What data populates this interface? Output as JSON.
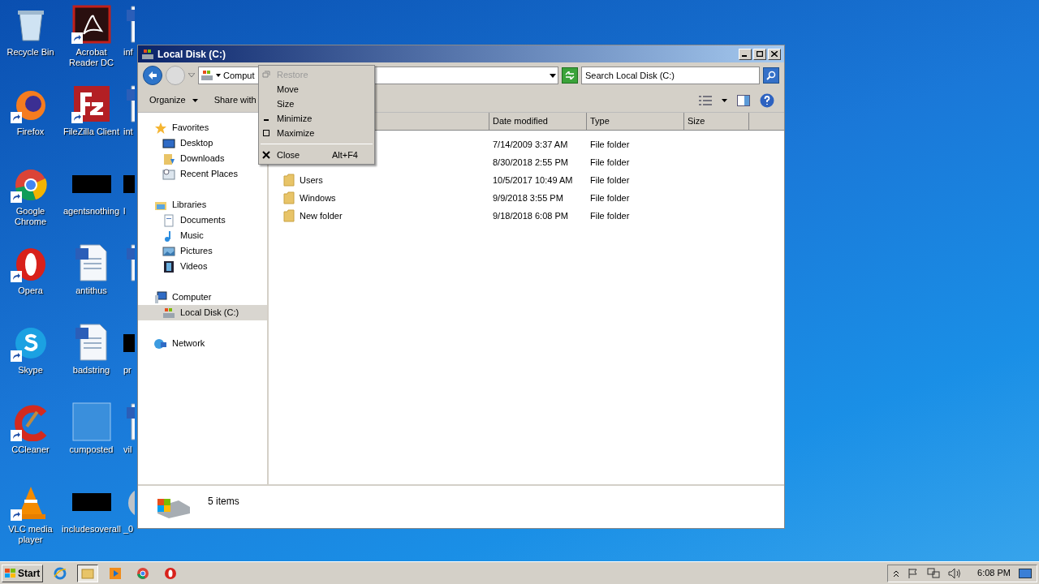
{
  "desktop_icons": [
    {
      "label": "Recycle Bin",
      "kind": "recycle",
      "shortcut": false
    },
    {
      "label": "Firefox",
      "kind": "firefox",
      "shortcut": true
    },
    {
      "label": "Google Chrome",
      "kind": "chrome",
      "shortcut": true
    },
    {
      "label": "Opera",
      "kind": "opera",
      "shortcut": true
    },
    {
      "label": "Skype",
      "kind": "skype",
      "shortcut": true
    },
    {
      "label": "CCleaner",
      "kind": "ccleaner",
      "shortcut": true
    },
    {
      "label": "VLC media player",
      "kind": "vlc",
      "shortcut": true
    },
    {
      "label": "Acrobat Reader DC",
      "kind": "pdf",
      "shortcut": true
    },
    {
      "label": "FileZilla Client",
      "kind": "filezilla",
      "shortcut": true
    },
    {
      "label": "agentsnothing",
      "kind": "black",
      "shortcut": false
    },
    {
      "label": "antithus",
      "kind": "word",
      "shortcut": false
    },
    {
      "label": "badstring",
      "kind": "word",
      "shortcut": false
    },
    {
      "label": "cumposted",
      "kind": "blank",
      "shortcut": false
    },
    {
      "label": "includesoverall",
      "kind": "black",
      "shortcut": false
    }
  ],
  "partial_icons": [
    {
      "label": "inf",
      "kind": "word"
    },
    {
      "label": "int",
      "kind": "word"
    },
    {
      "label": "l",
      "kind": "black"
    },
    {
      "kind": "word"
    },
    {
      "label": "pr",
      "kind": "black"
    },
    {
      "label": "vil",
      "kind": "word"
    },
    {
      "label": "_0",
      "kind": "disc"
    }
  ],
  "window": {
    "title": "Local Disk (C:)",
    "address": "Comput",
    "search": {
      "placeholder": "Search Local Disk (C:)"
    },
    "toolbar": [
      "Organize",
      "Share with"
    ],
    "sidebar": [
      {
        "label": "Favorites",
        "kind": "star",
        "selected": false,
        "children": [
          {
            "label": "Desktop",
            "kind": "desktop",
            "selected": false
          },
          {
            "label": "Downloads",
            "kind": "downloads",
            "selected": false
          },
          {
            "label": "Recent Places",
            "kind": "recent",
            "selected": false
          }
        ]
      },
      {
        "label": "Libraries",
        "kind": "library",
        "selected": false,
        "children": [
          {
            "label": "Documents",
            "kind": "documents",
            "selected": false
          },
          {
            "label": "Music",
            "kind": "music",
            "selected": false
          },
          {
            "label": "Pictures",
            "kind": "pictures",
            "selected": false
          },
          {
            "label": "Videos",
            "kind": "videos",
            "selected": false
          }
        ]
      },
      {
        "label": "Computer",
        "kind": "computer",
        "selected": false,
        "children": [
          {
            "label": "Local Disk (C:)",
            "kind": "drive",
            "selected": true
          }
        ]
      },
      {
        "label": "Network",
        "kind": "network",
        "selected": false
      }
    ],
    "columns": [
      "Date modified",
      "Type",
      "Size"
    ],
    "rows": [
      {
        "date": "7/14/2009 3:37 AM",
        "type": "File folder"
      },
      {
        "date": "8/30/2018 2:55 PM",
        "type": "File folder"
      },
      {
        "name": "Users",
        "date": "10/5/2017 10:49 AM",
        "type": "File folder"
      },
      {
        "name": "Windows",
        "date": "9/9/2018 3:55 PM",
        "type": "File folder"
      },
      {
        "name": "New folder",
        "date": "9/18/2018 6:08 PM",
        "type": "File folder"
      }
    ],
    "status": "5 items"
  },
  "system_menu": [
    {
      "label": "Restore",
      "kind": "restore",
      "disabled": true
    },
    {
      "label": "Move",
      "kind": "plain",
      "disabled": false
    },
    {
      "label": "Size",
      "kind": "plain",
      "disabled": false
    },
    {
      "label": "Minimize",
      "kind": "minimize",
      "disabled": false
    },
    {
      "label": "Maximize",
      "kind": "maximize",
      "disabled": false
    },
    {
      "label": "Close",
      "kind": "close",
      "shortcut": "Alt+F4",
      "disabled": false
    }
  ],
  "taskbar": {
    "start": "Start",
    "apps": [
      {
        "kind": "ie",
        "selected": false
      },
      {
        "kind": "explorer",
        "selected": true
      },
      {
        "kind": "media",
        "selected": false
      },
      {
        "kind": "chrome",
        "selected": false
      },
      {
        "kind": "opera",
        "selected": false
      }
    ],
    "clock": "6:08 PM"
  }
}
